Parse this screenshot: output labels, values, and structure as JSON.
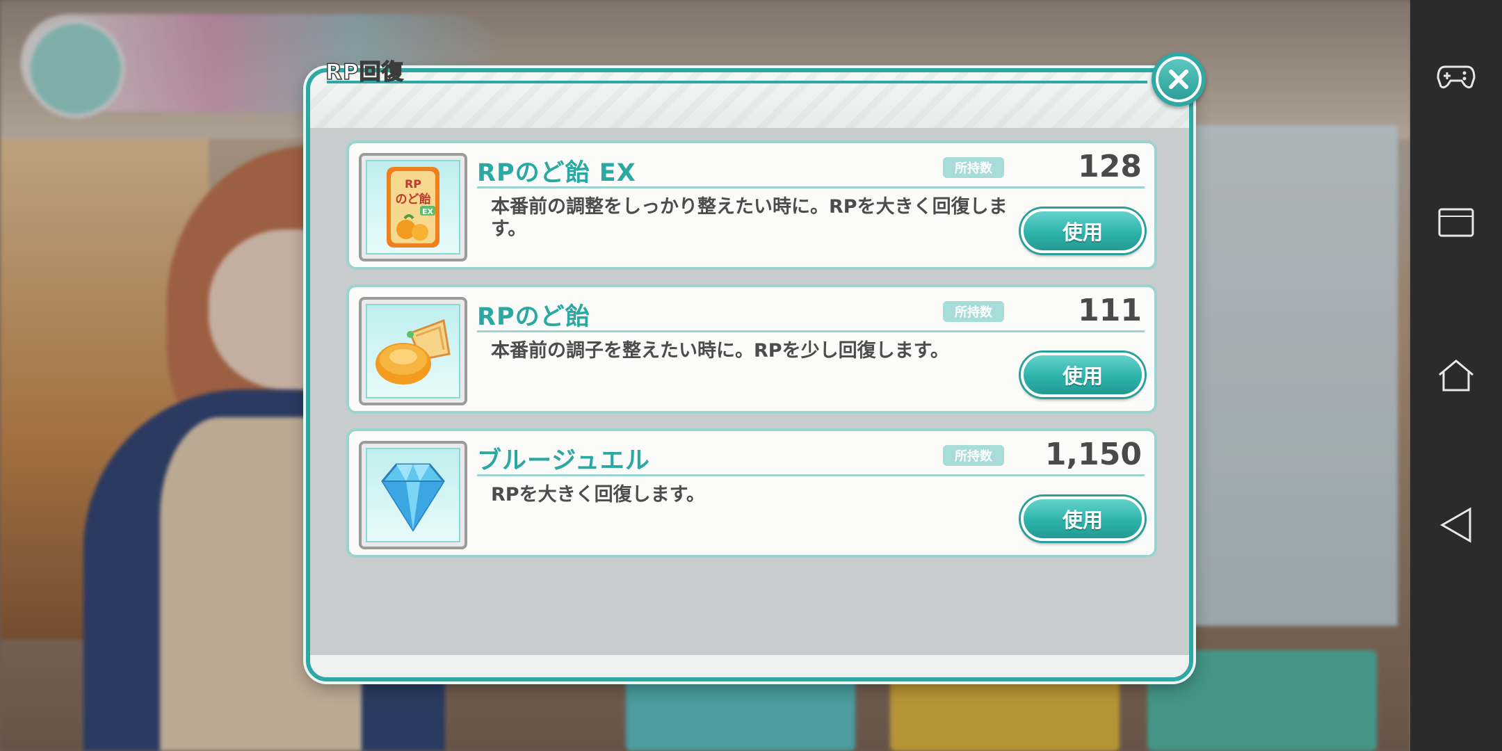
{
  "dialog": {
    "title": "RP回復",
    "close_icon": "close-icon"
  },
  "items": [
    {
      "name": "RPのど飴 EX",
      "owned_label": "所持数",
      "owned_count": "128",
      "description": "本番前の調整をしっかり整えたい時に。RPを大きく回復します。",
      "use_label": "使用",
      "icon": "candy-bag-ex-icon",
      "icon_text": "RPのど飴EX"
    },
    {
      "name": "RPのど飴",
      "owned_label": "所持数",
      "owned_count": "111",
      "description": "本番前の調子を整えたい時に。RPを少し回復します。",
      "use_label": "使用",
      "icon": "wrapped-candy-icon"
    },
    {
      "name": "ブルージュエル",
      "owned_label": "所持数",
      "owned_count": "1,150",
      "description": "RPを大きく回復します。",
      "use_label": "使用",
      "icon": "blue-jewel-icon"
    }
  ],
  "navigation_bar": {
    "icons": [
      "gamepad-icon",
      "recent-apps-icon",
      "home-icon",
      "back-icon"
    ]
  },
  "colors": {
    "accent": "#2fa8a3",
    "card_border": "#9ad3d0",
    "button": "#2db3aa"
  }
}
